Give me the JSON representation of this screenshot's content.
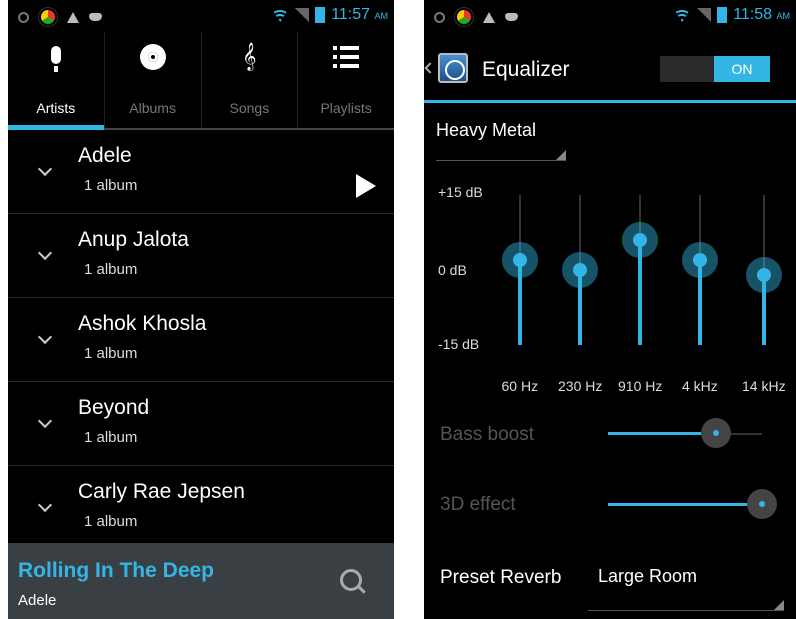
{
  "statusbar_left": {
    "time": "11:57",
    "ampm": "AM"
  },
  "statusbar_right": {
    "time": "11:58",
    "ampm": "AM"
  },
  "music": {
    "tabs": [
      {
        "label": "Artists",
        "icon": "microphone-icon",
        "active": true
      },
      {
        "label": "Albums",
        "icon": "disc-icon",
        "active": false
      },
      {
        "label": "Songs",
        "icon": "treble-clef-icon",
        "active": false
      },
      {
        "label": "Playlists",
        "icon": "list-icon",
        "active": false
      }
    ],
    "artists": [
      {
        "name": "Adele",
        "count": "1 album"
      },
      {
        "name": "Anup Jalota",
        "count": "1 album"
      },
      {
        "name": "Ashok Khosla",
        "count": "1 album"
      },
      {
        "name": "Beyond",
        "count": "1 album"
      },
      {
        "name": "Carly Rae Jepsen",
        "count": "1 album"
      }
    ],
    "now_playing": {
      "title": "Rolling In The Deep",
      "artist": "Adele"
    }
  },
  "equalizer": {
    "title": "Equalizer",
    "toggle": "ON",
    "preset": "Heavy Metal",
    "db_labels": {
      "top": "+15 dB",
      "mid": "0 dB",
      "bottom": "-15 dB"
    },
    "bands": [
      {
        "freq": "60 Hz",
        "level_db": 2
      },
      {
        "freq": "230 Hz",
        "level_db": 0
      },
      {
        "freq": "910 Hz",
        "level_db": 6
      },
      {
        "freq": "4 kHz",
        "level_db": 2
      },
      {
        "freq": "14 kHz",
        "level_db": -1
      }
    ],
    "bass_boost": {
      "label": "Bass boost",
      "value": 0.7
    },
    "effect_3d": {
      "label": "3D effect",
      "value": 1.0
    },
    "reverb": {
      "label": "Preset Reverb",
      "value": "Large Room"
    },
    "accent": "#33b5e5"
  }
}
